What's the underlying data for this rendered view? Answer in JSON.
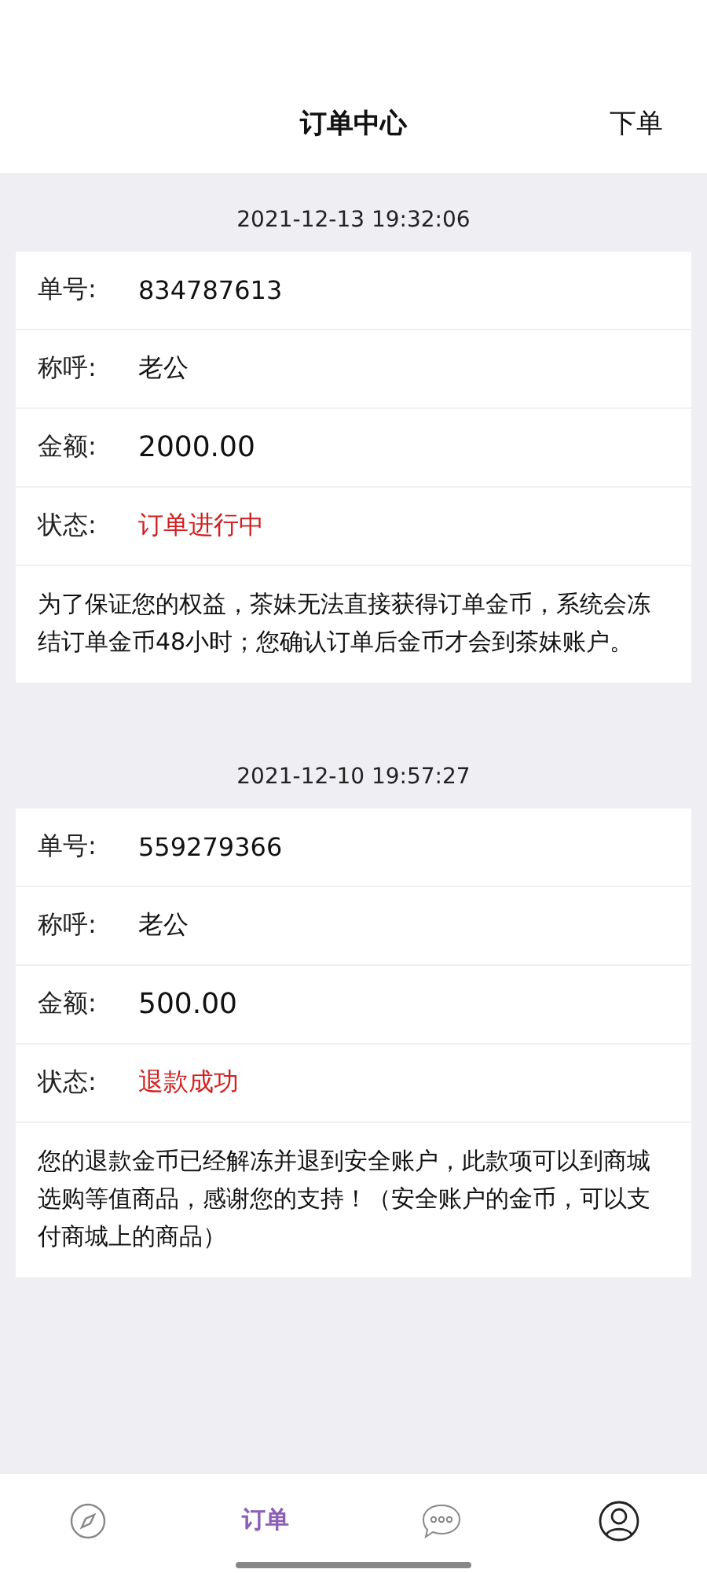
{
  "header": {
    "title": "订单中心",
    "action": "下单"
  },
  "orders": [
    {
      "time": "2021-12-13 19:32:06",
      "rows": [
        {
          "kind": "text",
          "label": "单号:",
          "value": "834787613"
        },
        {
          "kind": "text",
          "label": "称呼:",
          "value": "老公"
        },
        {
          "kind": "amount",
          "label": "金额:",
          "value": "2000.00"
        },
        {
          "kind": "status",
          "label": "状态:",
          "value": "订单进行中"
        }
      ],
      "note": "为了保证您的权益，茶妹无法直接获得订单金币，系统会冻结订单金币48小时；您确认订单后金币才会到茶妹账户。"
    },
    {
      "time": "2021-12-10 19:57:27",
      "rows": [
        {
          "kind": "text",
          "label": "单号:",
          "value": "559279366"
        },
        {
          "kind": "text",
          "label": "称呼:",
          "value": "老公"
        },
        {
          "kind": "amount",
          "label": "金额:",
          "value": "500.00"
        },
        {
          "kind": "status",
          "label": "状态:",
          "value": "退款成功"
        }
      ],
      "note": "您的退款金币已经解冻并退到安全账户，此款项可以到商城选购等值商品，感谢您的支持！（安全账户的金币，可以支付商城上的商品）"
    }
  ],
  "tabs": [
    {
      "kind": "compass",
      "selected": false
    },
    {
      "kind": "label",
      "label": "订单",
      "selected": true
    },
    {
      "kind": "chat",
      "selected": false
    },
    {
      "kind": "person",
      "selected": false
    }
  ]
}
